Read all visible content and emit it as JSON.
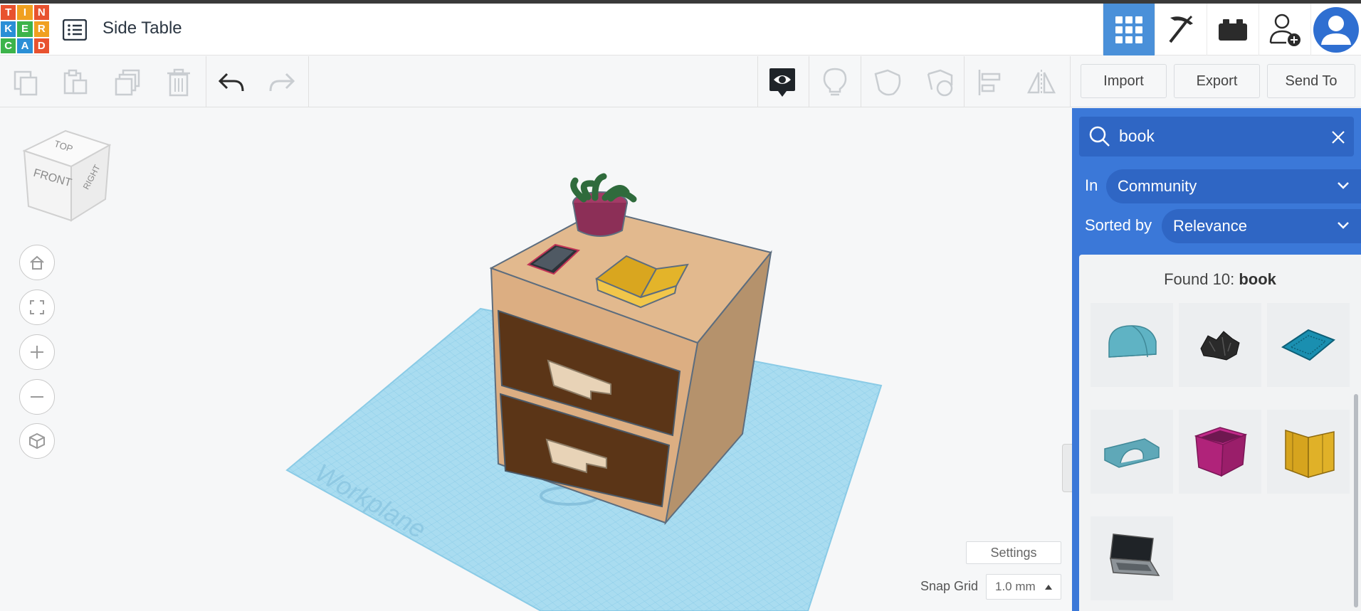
{
  "logo": {
    "letters": [
      "T",
      "I",
      "N",
      "K",
      "E",
      "R",
      "C",
      "A",
      "D"
    ],
    "colors": [
      "#e8522f",
      "#f0a020",
      "#e8522f",
      "#2a8fd6",
      "#3cb44b",
      "#f0a020",
      "#3cb44b",
      "#2a8fd6",
      "#e8522f"
    ]
  },
  "header": {
    "title": "Side Table",
    "icons": [
      "grid-view-icon",
      "pickaxe-icon",
      "bricks-icon",
      "invite-user-icon",
      "user-avatar-icon"
    ]
  },
  "toolbar": {
    "buttons": [
      "copy-icon",
      "paste-icon",
      "duplicate-icon",
      "delete-icon",
      "undo-icon",
      "redo-icon",
      "notes-icon",
      "light-bulb-icon",
      "shape-solid-icon",
      "shape-hole-icon",
      "align-icon",
      "mirror-icon"
    ],
    "import_label": "Import",
    "export_label": "Export",
    "sendto_label": "Send To"
  },
  "viewcube": {
    "top": "TOP",
    "front": "FRONT",
    "right": "RIGHT"
  },
  "viewport": {
    "workplane_label": "Workplane",
    "settings_label": "Settings",
    "snap_label": "Snap Grid",
    "snap_value": "1.0 mm"
  },
  "panel": {
    "search_value": "book",
    "in_label": "In",
    "in_value": "Community",
    "sorted_label": "Sorted by",
    "sorted_value": "Relevance",
    "found_prefix": "Found 10:",
    "found_term": "book",
    "results": [
      "half-cylinder-shape",
      "black-rubble-shape",
      "blue-tile-shape",
      "arch-block-shape",
      "magenta-box-shape",
      "yellow-book-shape",
      "laptop-shape"
    ]
  },
  "colors": {
    "accent": "#3b78d8",
    "accent_dark": "#2f66c4",
    "workplane": "#a9dcf0"
  }
}
